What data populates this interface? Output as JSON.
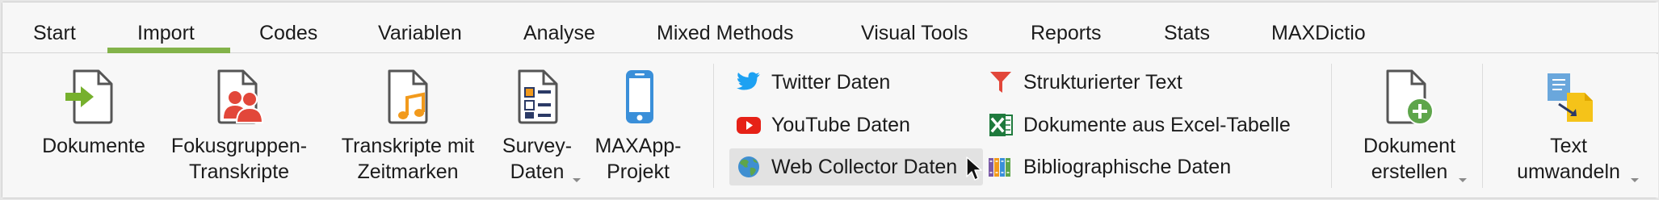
{
  "tabs": [
    {
      "label": "Start",
      "selected": false
    },
    {
      "label": "Import",
      "selected": true
    },
    {
      "label": "Codes",
      "selected": false
    },
    {
      "label": "Variablen",
      "selected": false
    },
    {
      "label": "Analyse",
      "selected": false
    },
    {
      "label": "Mixed Methods",
      "selected": false
    },
    {
      "label": "Visual Tools",
      "selected": false
    },
    {
      "label": "Reports",
      "selected": false
    },
    {
      "label": "Stats",
      "selected": false
    },
    {
      "label": "MAXDictio",
      "selected": false
    }
  ],
  "ribbon": {
    "dokumente": {
      "line1": "Dokumente",
      "line2": "",
      "icon": "document-import-icon"
    },
    "fokusgruppen": {
      "line1": "Fokusgruppen-",
      "line2": "Transkripte",
      "icon": "focus-group-document-icon"
    },
    "transkripte": {
      "line1": "Transkripte mit",
      "line2": "Zeitmarken",
      "icon": "audio-transcript-icon"
    },
    "survey": {
      "line1": "Survey-",
      "line2": "Daten",
      "icon": "survey-data-icon",
      "has_dropdown": true
    },
    "maxapp": {
      "line1": "MAXApp-",
      "line2": "Projekt",
      "icon": "mobile-phone-icon"
    },
    "twitter": {
      "label": "Twitter Daten",
      "icon": "twitter-bird-icon"
    },
    "youtube": {
      "label": "YouTube Daten",
      "icon": "youtube-play-icon"
    },
    "webcollector": {
      "label": "Web Collector Daten",
      "icon": "globe-icon",
      "hovered": true
    },
    "strukturiert": {
      "label": "Strukturierter Text",
      "icon": "red-funnel-icon"
    },
    "excel": {
      "label": "Dokumente aus Excel-Tabelle",
      "icon": "excel-icon"
    },
    "biblio": {
      "label": "Bibliographische Daten",
      "icon": "books-icon"
    },
    "dokument_erstellen": {
      "line1": "Dokument",
      "line2": "erstellen",
      "icon": "document-add-icon",
      "has_dropdown": true
    },
    "text_umwandeln": {
      "line1": "Text",
      "line2": "umwandeln",
      "icon": "text-convert-icon",
      "has_dropdown": true
    }
  },
  "colors": {
    "accent_green": "#83b34a",
    "icon_red": "#e2473a",
    "icon_orange": "#f29a1c",
    "icon_blue": "#3a8fd9",
    "twitter_blue": "#1da1f2",
    "youtube_red": "#e62117",
    "excel_green": "#1f7a3d"
  }
}
